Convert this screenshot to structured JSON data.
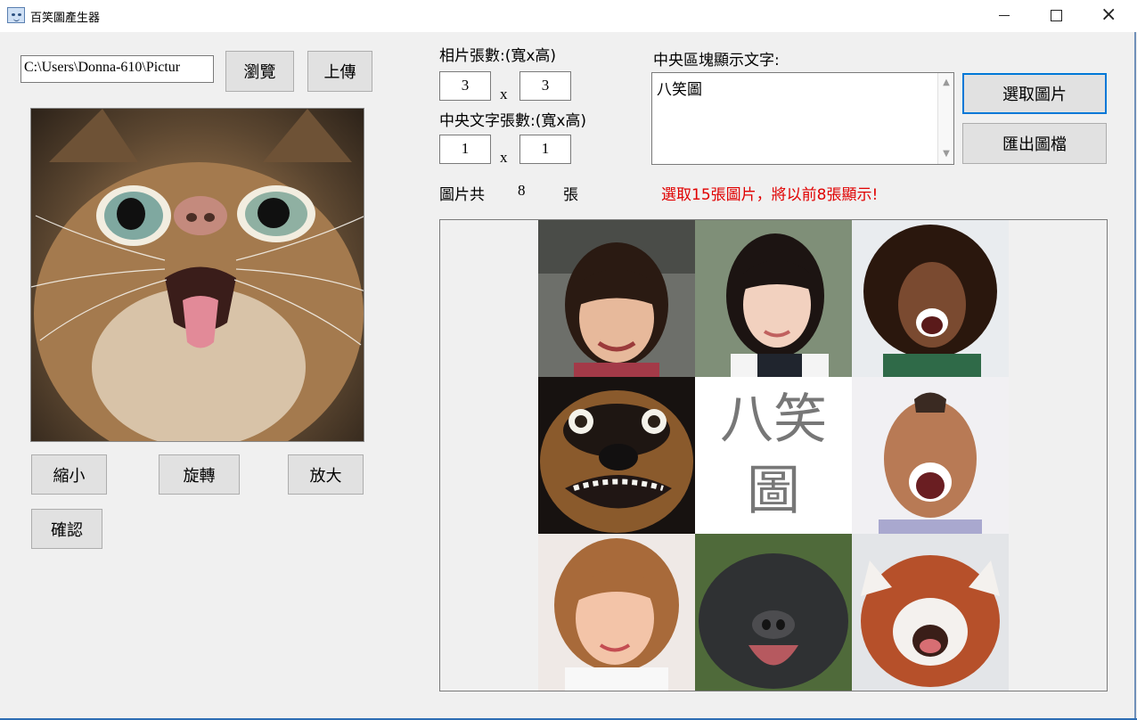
{
  "window": {
    "title": "百笑圖產生器",
    "icon": "cat-face-icon"
  },
  "file": {
    "path": "C:\\Users\\Donna-610\\Pictur"
  },
  "buttons": {
    "browse": "瀏覽",
    "upload": "上傳",
    "shrink": "縮小",
    "rotate": "旋轉",
    "enlarge": "放大",
    "confirm": "確認",
    "select_images": "選取圖片",
    "export": "匯出圖檔"
  },
  "grid": {
    "photo_label": "相片張數:(寬x高)",
    "photo_width": "3",
    "photo_height": "3",
    "center_label": "中央文字張數:(寬x高)",
    "center_width": "1",
    "center_height": "1",
    "times": "x"
  },
  "text_block": {
    "label": "中央區塊顯示文字:",
    "value": "八笑圖"
  },
  "count": {
    "prefix": "圖片共",
    "value": "8",
    "suffix": "張"
  },
  "warning": "選取15張圖片，將以前8張顯示!",
  "collage": {
    "center_line1": "八笑",
    "center_line2": "圖"
  },
  "colors": {
    "warning": "#e00000",
    "focus": "#0078d7"
  }
}
